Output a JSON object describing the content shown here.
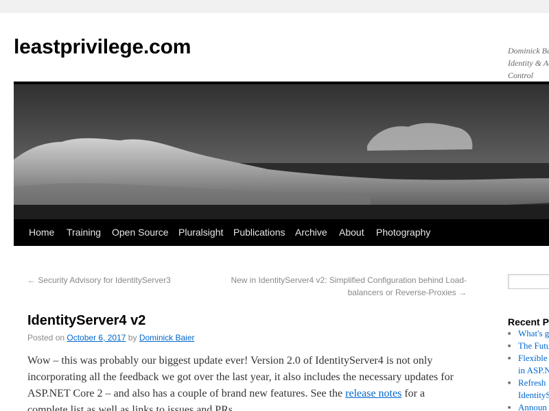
{
  "site": {
    "title": "leastprivilege.com",
    "tagline": "Dominick Baier on Identity & Access Control"
  },
  "nav": {
    "items": [
      "Home",
      "Training",
      "Open Source",
      "Pluralsight",
      "Publications",
      "Archive",
      "About",
      "Photography"
    ]
  },
  "post_nav": {
    "prev": "← Security Advisory for IdentityServer3",
    "next": "New in IdentityServer4 v2: Simplified Configuration behind Load-balancers or Reverse-Proxies →"
  },
  "post": {
    "title": "IdentityServer4 v2",
    "posted_on_label": "Posted on",
    "date": "October 6, 2017",
    "by_label": "by",
    "author": "Dominick Baier",
    "body_text": "Wow – this was probably our biggest update ever! Version 2.0 of IdentityServer4 is not only incorporating all the feedback we got over the last year, it also includes the necessary updates for ASP.NET Core 2 – and also has a couple of brand new features. See the ",
    "link_text": "release notes",
    "body_after_link": " for a complete list as well as links to issues and PRs."
  },
  "sidebar": {
    "recent_title": "Recent Posts",
    "recent_posts": [
      "What's g",
      "The Futu",
      "Flexible",
      "in ASP.N",
      "Refresh",
      "IdentityS",
      "Announ"
    ]
  },
  "colors": {
    "link": "#0066cc",
    "nav_background": "#000000",
    "nav_text": "#e6e6e6"
  }
}
